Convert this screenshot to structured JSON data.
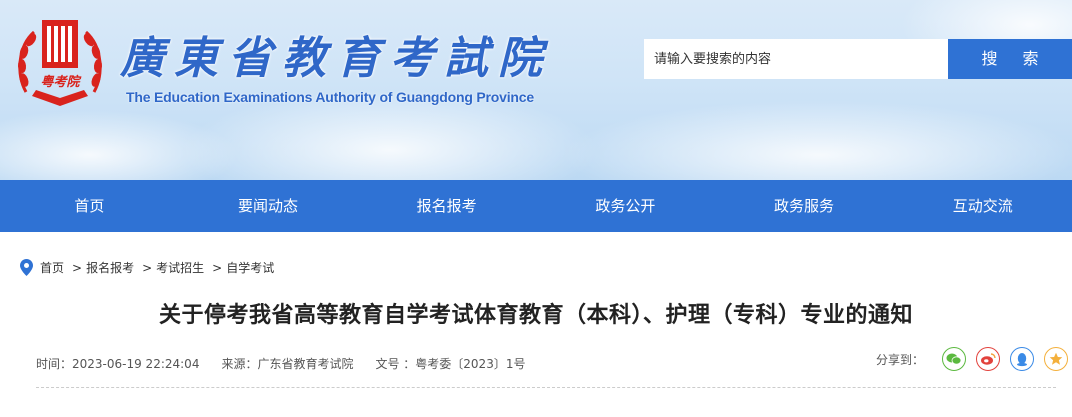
{
  "header": {
    "title": "廣東省教育考試院",
    "subtitle": "The Education Examinations Authority of Guangdong Province",
    "logo_text": "粤考院",
    "search": {
      "placeholder": "请输入要搜索的内容",
      "button_label": "搜 索"
    }
  },
  "nav": {
    "items": [
      "首页",
      "要闻动态",
      "报名报考",
      "政务公开",
      "政务服务",
      "互动交流"
    ]
  },
  "breadcrumb": {
    "items": [
      "首页",
      "报名报考",
      "考试招生",
      "自学考试"
    ],
    "separator": ">"
  },
  "article": {
    "title": "关于停考我省高等教育自学考试体育教育（本科）、护理（专科）专业的通知",
    "time": "时间：2023-06-19 22:24:04",
    "source": "来源：广东省教育考试院",
    "doc_no": "文号 ：粤考委〔2023〕1号"
  },
  "share": {
    "label": "分享到：",
    "icons": [
      {
        "name": "wechat-icon",
        "color": "#5bb93f"
      },
      {
        "name": "weibo-icon",
        "color": "#e2423c"
      },
      {
        "name": "qq-icon",
        "color": "#3a8ae6"
      },
      {
        "name": "qzone-icon",
        "color": "#f4b03c"
      }
    ]
  },
  "colors": {
    "accent": "#2f72d4",
    "brand_red": "#d9231d"
  }
}
